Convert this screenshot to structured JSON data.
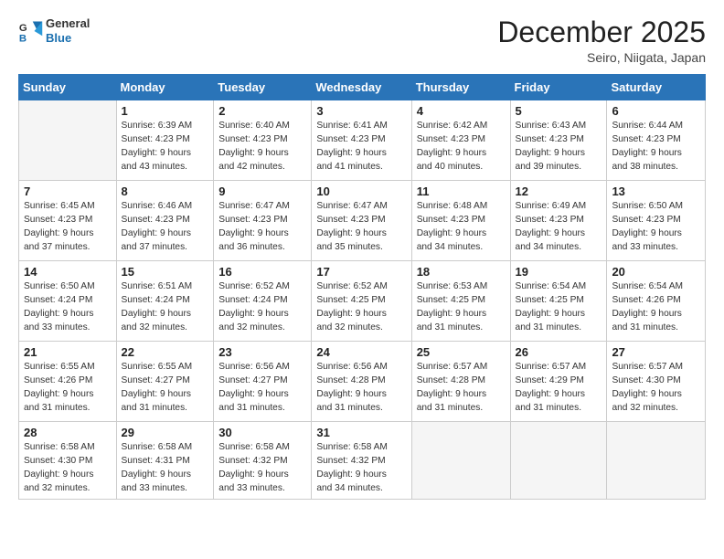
{
  "logo": {
    "line1": "General",
    "line2": "Blue"
  },
  "title": "December 2025",
  "location": "Seiro, Niigata, Japan",
  "weekdays": [
    "Sunday",
    "Monday",
    "Tuesday",
    "Wednesday",
    "Thursday",
    "Friday",
    "Saturday"
  ],
  "weeks": [
    [
      {
        "day": "",
        "info": ""
      },
      {
        "day": "1",
        "info": "Sunrise: 6:39 AM\nSunset: 4:23 PM\nDaylight: 9 hours\nand 43 minutes."
      },
      {
        "day": "2",
        "info": "Sunrise: 6:40 AM\nSunset: 4:23 PM\nDaylight: 9 hours\nand 42 minutes."
      },
      {
        "day": "3",
        "info": "Sunrise: 6:41 AM\nSunset: 4:23 PM\nDaylight: 9 hours\nand 41 minutes."
      },
      {
        "day": "4",
        "info": "Sunrise: 6:42 AM\nSunset: 4:23 PM\nDaylight: 9 hours\nand 40 minutes."
      },
      {
        "day": "5",
        "info": "Sunrise: 6:43 AM\nSunset: 4:23 PM\nDaylight: 9 hours\nand 39 minutes."
      },
      {
        "day": "6",
        "info": "Sunrise: 6:44 AM\nSunset: 4:23 PM\nDaylight: 9 hours\nand 38 minutes."
      }
    ],
    [
      {
        "day": "7",
        "info": "Sunrise: 6:45 AM\nSunset: 4:23 PM\nDaylight: 9 hours\nand 37 minutes."
      },
      {
        "day": "8",
        "info": "Sunrise: 6:46 AM\nSunset: 4:23 PM\nDaylight: 9 hours\nand 37 minutes."
      },
      {
        "day": "9",
        "info": "Sunrise: 6:47 AM\nSunset: 4:23 PM\nDaylight: 9 hours\nand 36 minutes."
      },
      {
        "day": "10",
        "info": "Sunrise: 6:47 AM\nSunset: 4:23 PM\nDaylight: 9 hours\nand 35 minutes."
      },
      {
        "day": "11",
        "info": "Sunrise: 6:48 AM\nSunset: 4:23 PM\nDaylight: 9 hours\nand 34 minutes."
      },
      {
        "day": "12",
        "info": "Sunrise: 6:49 AM\nSunset: 4:23 PM\nDaylight: 9 hours\nand 34 minutes."
      },
      {
        "day": "13",
        "info": "Sunrise: 6:50 AM\nSunset: 4:23 PM\nDaylight: 9 hours\nand 33 minutes."
      }
    ],
    [
      {
        "day": "14",
        "info": "Sunrise: 6:50 AM\nSunset: 4:24 PM\nDaylight: 9 hours\nand 33 minutes."
      },
      {
        "day": "15",
        "info": "Sunrise: 6:51 AM\nSunset: 4:24 PM\nDaylight: 9 hours\nand 32 minutes."
      },
      {
        "day": "16",
        "info": "Sunrise: 6:52 AM\nSunset: 4:24 PM\nDaylight: 9 hours\nand 32 minutes."
      },
      {
        "day": "17",
        "info": "Sunrise: 6:52 AM\nSunset: 4:25 PM\nDaylight: 9 hours\nand 32 minutes."
      },
      {
        "day": "18",
        "info": "Sunrise: 6:53 AM\nSunset: 4:25 PM\nDaylight: 9 hours\nand 31 minutes."
      },
      {
        "day": "19",
        "info": "Sunrise: 6:54 AM\nSunset: 4:25 PM\nDaylight: 9 hours\nand 31 minutes."
      },
      {
        "day": "20",
        "info": "Sunrise: 6:54 AM\nSunset: 4:26 PM\nDaylight: 9 hours\nand 31 minutes."
      }
    ],
    [
      {
        "day": "21",
        "info": "Sunrise: 6:55 AM\nSunset: 4:26 PM\nDaylight: 9 hours\nand 31 minutes."
      },
      {
        "day": "22",
        "info": "Sunrise: 6:55 AM\nSunset: 4:27 PM\nDaylight: 9 hours\nand 31 minutes."
      },
      {
        "day": "23",
        "info": "Sunrise: 6:56 AM\nSunset: 4:27 PM\nDaylight: 9 hours\nand 31 minutes."
      },
      {
        "day": "24",
        "info": "Sunrise: 6:56 AM\nSunset: 4:28 PM\nDaylight: 9 hours\nand 31 minutes."
      },
      {
        "day": "25",
        "info": "Sunrise: 6:57 AM\nSunset: 4:28 PM\nDaylight: 9 hours\nand 31 minutes."
      },
      {
        "day": "26",
        "info": "Sunrise: 6:57 AM\nSunset: 4:29 PM\nDaylight: 9 hours\nand 31 minutes."
      },
      {
        "day": "27",
        "info": "Sunrise: 6:57 AM\nSunset: 4:30 PM\nDaylight: 9 hours\nand 32 minutes."
      }
    ],
    [
      {
        "day": "28",
        "info": "Sunrise: 6:58 AM\nSunset: 4:30 PM\nDaylight: 9 hours\nand 32 minutes."
      },
      {
        "day": "29",
        "info": "Sunrise: 6:58 AM\nSunset: 4:31 PM\nDaylight: 9 hours\nand 33 minutes."
      },
      {
        "day": "30",
        "info": "Sunrise: 6:58 AM\nSunset: 4:32 PM\nDaylight: 9 hours\nand 33 minutes."
      },
      {
        "day": "31",
        "info": "Sunrise: 6:58 AM\nSunset: 4:32 PM\nDaylight: 9 hours\nand 34 minutes."
      },
      {
        "day": "",
        "info": ""
      },
      {
        "day": "",
        "info": ""
      },
      {
        "day": "",
        "info": ""
      }
    ]
  ]
}
